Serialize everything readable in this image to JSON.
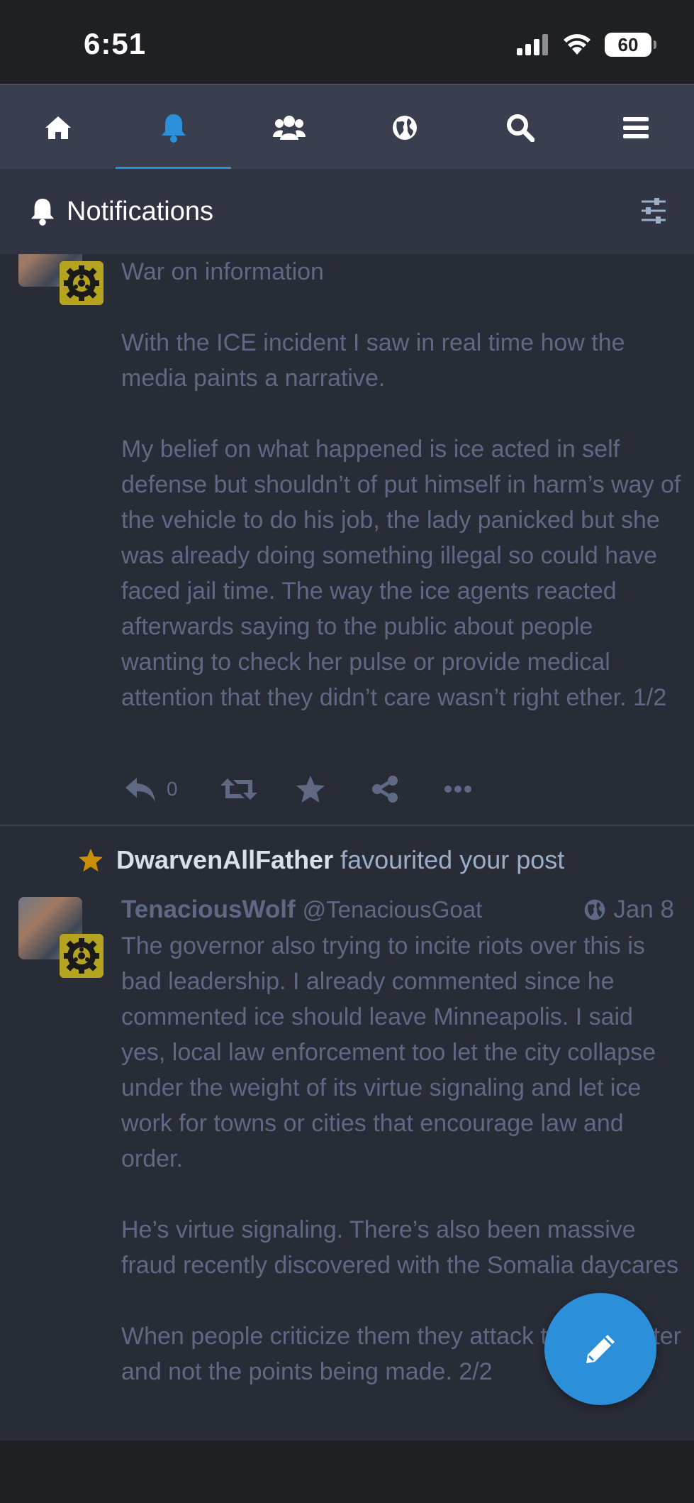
{
  "status_bar": {
    "time": "6:51",
    "battery": "60"
  },
  "nav": {
    "tabs": [
      {
        "icon": "home-icon"
      },
      {
        "icon": "bell-icon",
        "active": true
      },
      {
        "icon": "users-icon"
      },
      {
        "icon": "globe-icon"
      },
      {
        "icon": "search-icon"
      },
      {
        "icon": "menu-icon"
      }
    ]
  },
  "header": {
    "title": "Notifications"
  },
  "post1": {
    "text": "War on information\n\nWith the ICE incident I saw in real time how the media paints a narrative.\n\nMy belief on what happened is ice acted in self defense but shouldn’t of put himself in harm’s way of the vehicle to do his job, the lady panicked but she was already doing something illegal so could have faced jail time. The way the ice agents reacted afterwards saying to the public about people wanting to check her pulse or provide medical attention that they didn’t care wasn’t right ether. 1/2",
    "reply_count": "0"
  },
  "notification": {
    "account": "DwarvenAllFather",
    "action": "favourited your post"
  },
  "post2": {
    "display_name": "TenaciousWolf",
    "handle": "@TenaciousGoat",
    "date": "Jan 8",
    "text": "The governor also trying to incite riots over this is bad leadership. I already commented since he commented ice should leave Minneapolis. I said yes, local law enforcement too let the city collapse under the weight of its virtue signaling and let ice work for towns or cities that encourage law and order.\n\nHe’s virtue signaling. There’s also been massive fraud recently discovered with the Somalia daycares\n\nWhen people criticize them they attack the character and not the points being made. 2/2"
  },
  "colors": {
    "accent": "#2b90d9",
    "favourite_star": "#ca8f04",
    "background": "#282c37"
  }
}
